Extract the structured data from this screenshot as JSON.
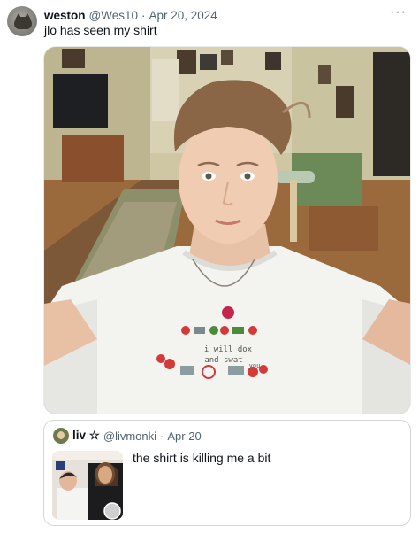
{
  "tweet": {
    "author_name": "weston",
    "author_handle": "@Wes10",
    "separator": "·",
    "date": "Apr 20, 2024",
    "text": "jlo has seen my shirt",
    "more_label": "···",
    "avatar_icon": "cat-avatar-icon"
  },
  "photo": {
    "description_icon": "selfie-photo",
    "shirt_text": [
      "i will dox",
      "and swat",
      "you"
    ]
  },
  "quote": {
    "author_name": "liv ☆",
    "author_handle": "@livmonki",
    "separator": "·",
    "date": "Apr 20",
    "text": "the shirt is killing me a bit"
  },
  "colors": {
    "text_primary": "#0f1419",
    "text_secondary": "#536471",
    "border": "#d3d7da"
  }
}
